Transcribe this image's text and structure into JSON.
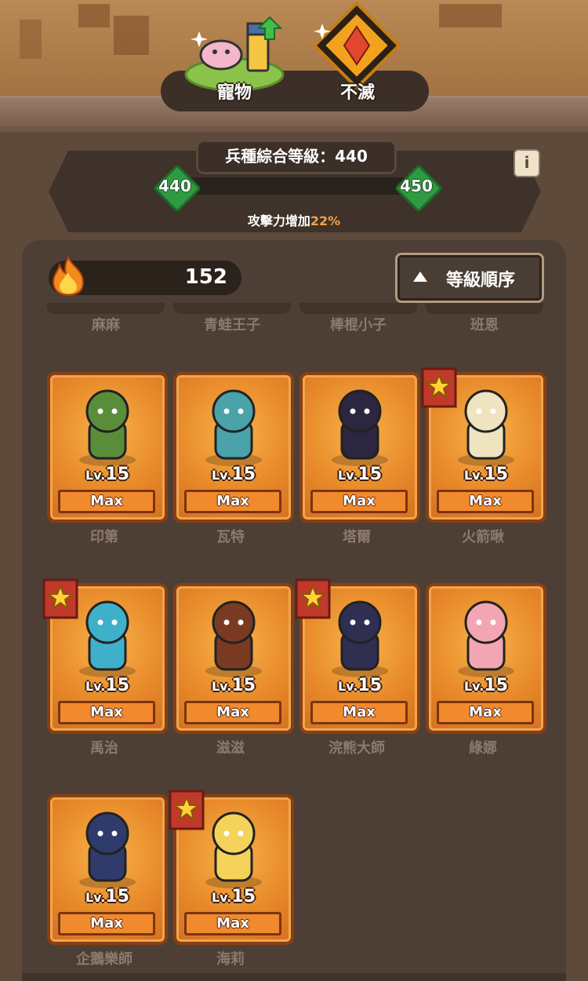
{
  "top_tabs": [
    {
      "label": "寵物",
      "icon": "pet-axolotl-icon"
    },
    {
      "label": "不滅",
      "icon": "immortal-gem-icon"
    }
  ],
  "level": {
    "title": "兵種綜合等級：440",
    "current": "440",
    "next": "450",
    "bonus_prefix": "攻擊力增加",
    "bonus_pct": "22%",
    "progress": 0
  },
  "resource": {
    "icon": "flame-icon",
    "value": "152"
  },
  "sort_button": {
    "label": "等級順序"
  },
  "cut_off_names": [
    "麻麻",
    "青蛙王子",
    "棒棍小子",
    "班恩"
  ],
  "units": [
    {
      "name": "印第",
      "lv_prefix": "Lv.",
      "level": "15",
      "status": "Max",
      "starred": false,
      "color": "#5a8d3a"
    },
    {
      "name": "瓦特",
      "lv_prefix": "Lv.",
      "level": "15",
      "status": "Max",
      "starred": false,
      "color": "#4aa3a8"
    },
    {
      "name": "塔爾",
      "lv_prefix": "Lv.",
      "level": "15",
      "status": "Max",
      "starred": false,
      "color": "#2c2640"
    },
    {
      "name": "火箭啾",
      "lv_prefix": "Lv.",
      "level": "15",
      "status": "Max",
      "starred": true,
      "color": "#f0e3c0"
    },
    {
      "name": "禹治",
      "lv_prefix": "Lv.",
      "level": "15",
      "status": "Max",
      "starred": true,
      "color": "#3fb0c9"
    },
    {
      "name": "滋滋",
      "lv_prefix": "Lv.",
      "level": "15",
      "status": "Max",
      "starred": false,
      "color": "#7a3a22"
    },
    {
      "name": "浣熊大師",
      "lv_prefix": "Lv.",
      "level": "15",
      "status": "Max",
      "starred": true,
      "color": "#2f2f52"
    },
    {
      "name": "綠娜",
      "lv_prefix": "Lv.",
      "level": "15",
      "status": "Max",
      "starred": false,
      "color": "#f2a6b3"
    },
    {
      "name": "企鵝樂師",
      "lv_prefix": "Lv.",
      "level": "15",
      "status": "Max",
      "starred": false,
      "color": "#2e3b6b"
    },
    {
      "name": "海莉",
      "lv_prefix": "Lv.",
      "level": "15",
      "status": "Max",
      "starred": true,
      "color": "#f5d35a"
    }
  ]
}
